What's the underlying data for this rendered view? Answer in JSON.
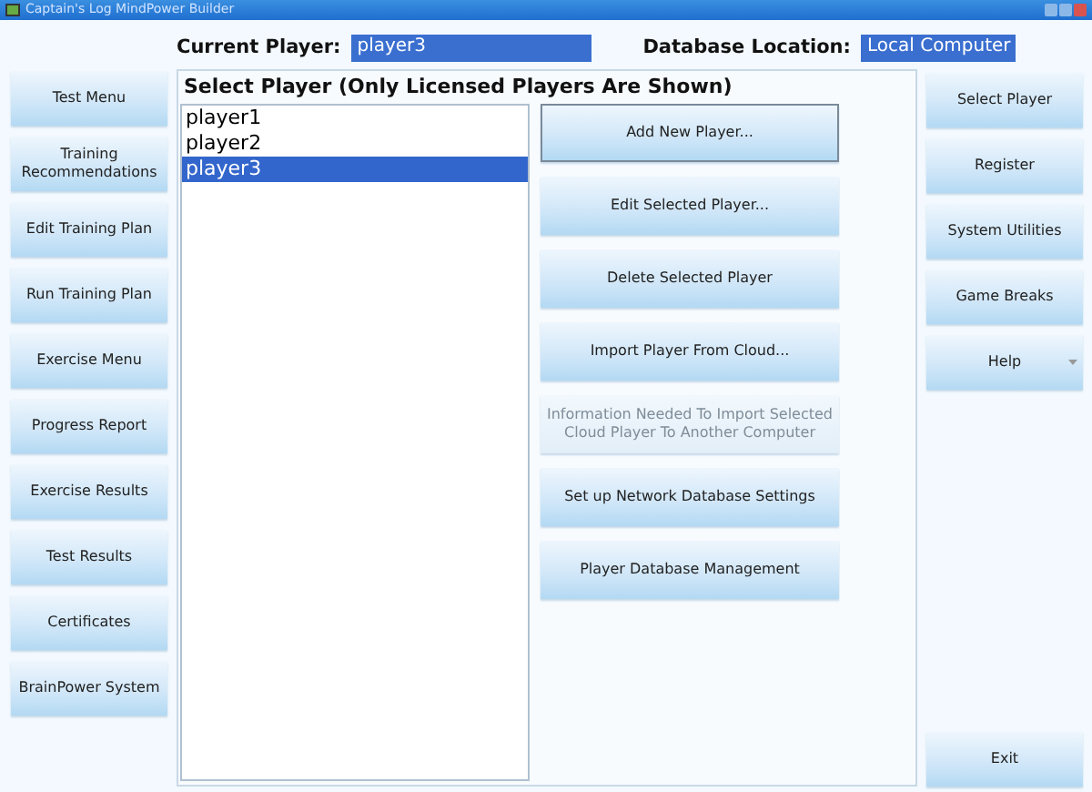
{
  "window": {
    "title": "Captain's Log MindPower Builder"
  },
  "header": {
    "current_player_label": "Current Player:",
    "current_player": "player3",
    "database_label": "Database Location:",
    "database": "Local Computer"
  },
  "left_menu": [
    {
      "label": "Test Menu"
    },
    {
      "label": "Training Recommendations"
    },
    {
      "label": "Edit Training Plan"
    },
    {
      "label": "Run Training Plan"
    },
    {
      "label": "Exercise Menu"
    },
    {
      "label": "Progress Report"
    },
    {
      "label": "Exercise Results"
    },
    {
      "label": "Test Results"
    },
    {
      "label": "Certificates"
    },
    {
      "label": "BrainPower System"
    }
  ],
  "panel": {
    "title": "Select Player (Only Licensed Players Are Shown)",
    "players": [
      {
        "name": "player1",
        "selected": false
      },
      {
        "name": "player2",
        "selected": false
      },
      {
        "name": "player3",
        "selected": true
      }
    ],
    "actions": [
      {
        "label": "Add New Player...",
        "disabled": false,
        "focused": true
      },
      {
        "label": "Edit Selected Player...",
        "disabled": false,
        "focused": false
      },
      {
        "label": "Delete Selected Player",
        "disabled": false,
        "focused": false
      },
      {
        "label": "Import Player From Cloud...",
        "disabled": false,
        "focused": false
      },
      {
        "label": "Information Needed To Import Selected Cloud Player To Another Computer",
        "disabled": true,
        "focused": false
      },
      {
        "label": "Set up Network Database Settings",
        "disabled": false,
        "focused": false
      },
      {
        "label": "Player Database Management",
        "disabled": false,
        "focused": false
      }
    ]
  },
  "right_menu": [
    {
      "label": "Select Player",
      "kind": "plain"
    },
    {
      "label": "Register",
      "kind": "plain"
    },
    {
      "label": "System Utilities",
      "kind": "plain"
    },
    {
      "label": "Game Breaks",
      "kind": "plain"
    },
    {
      "label": "Help",
      "kind": "dropdown"
    }
  ],
  "exit_button": {
    "label": "Exit"
  }
}
